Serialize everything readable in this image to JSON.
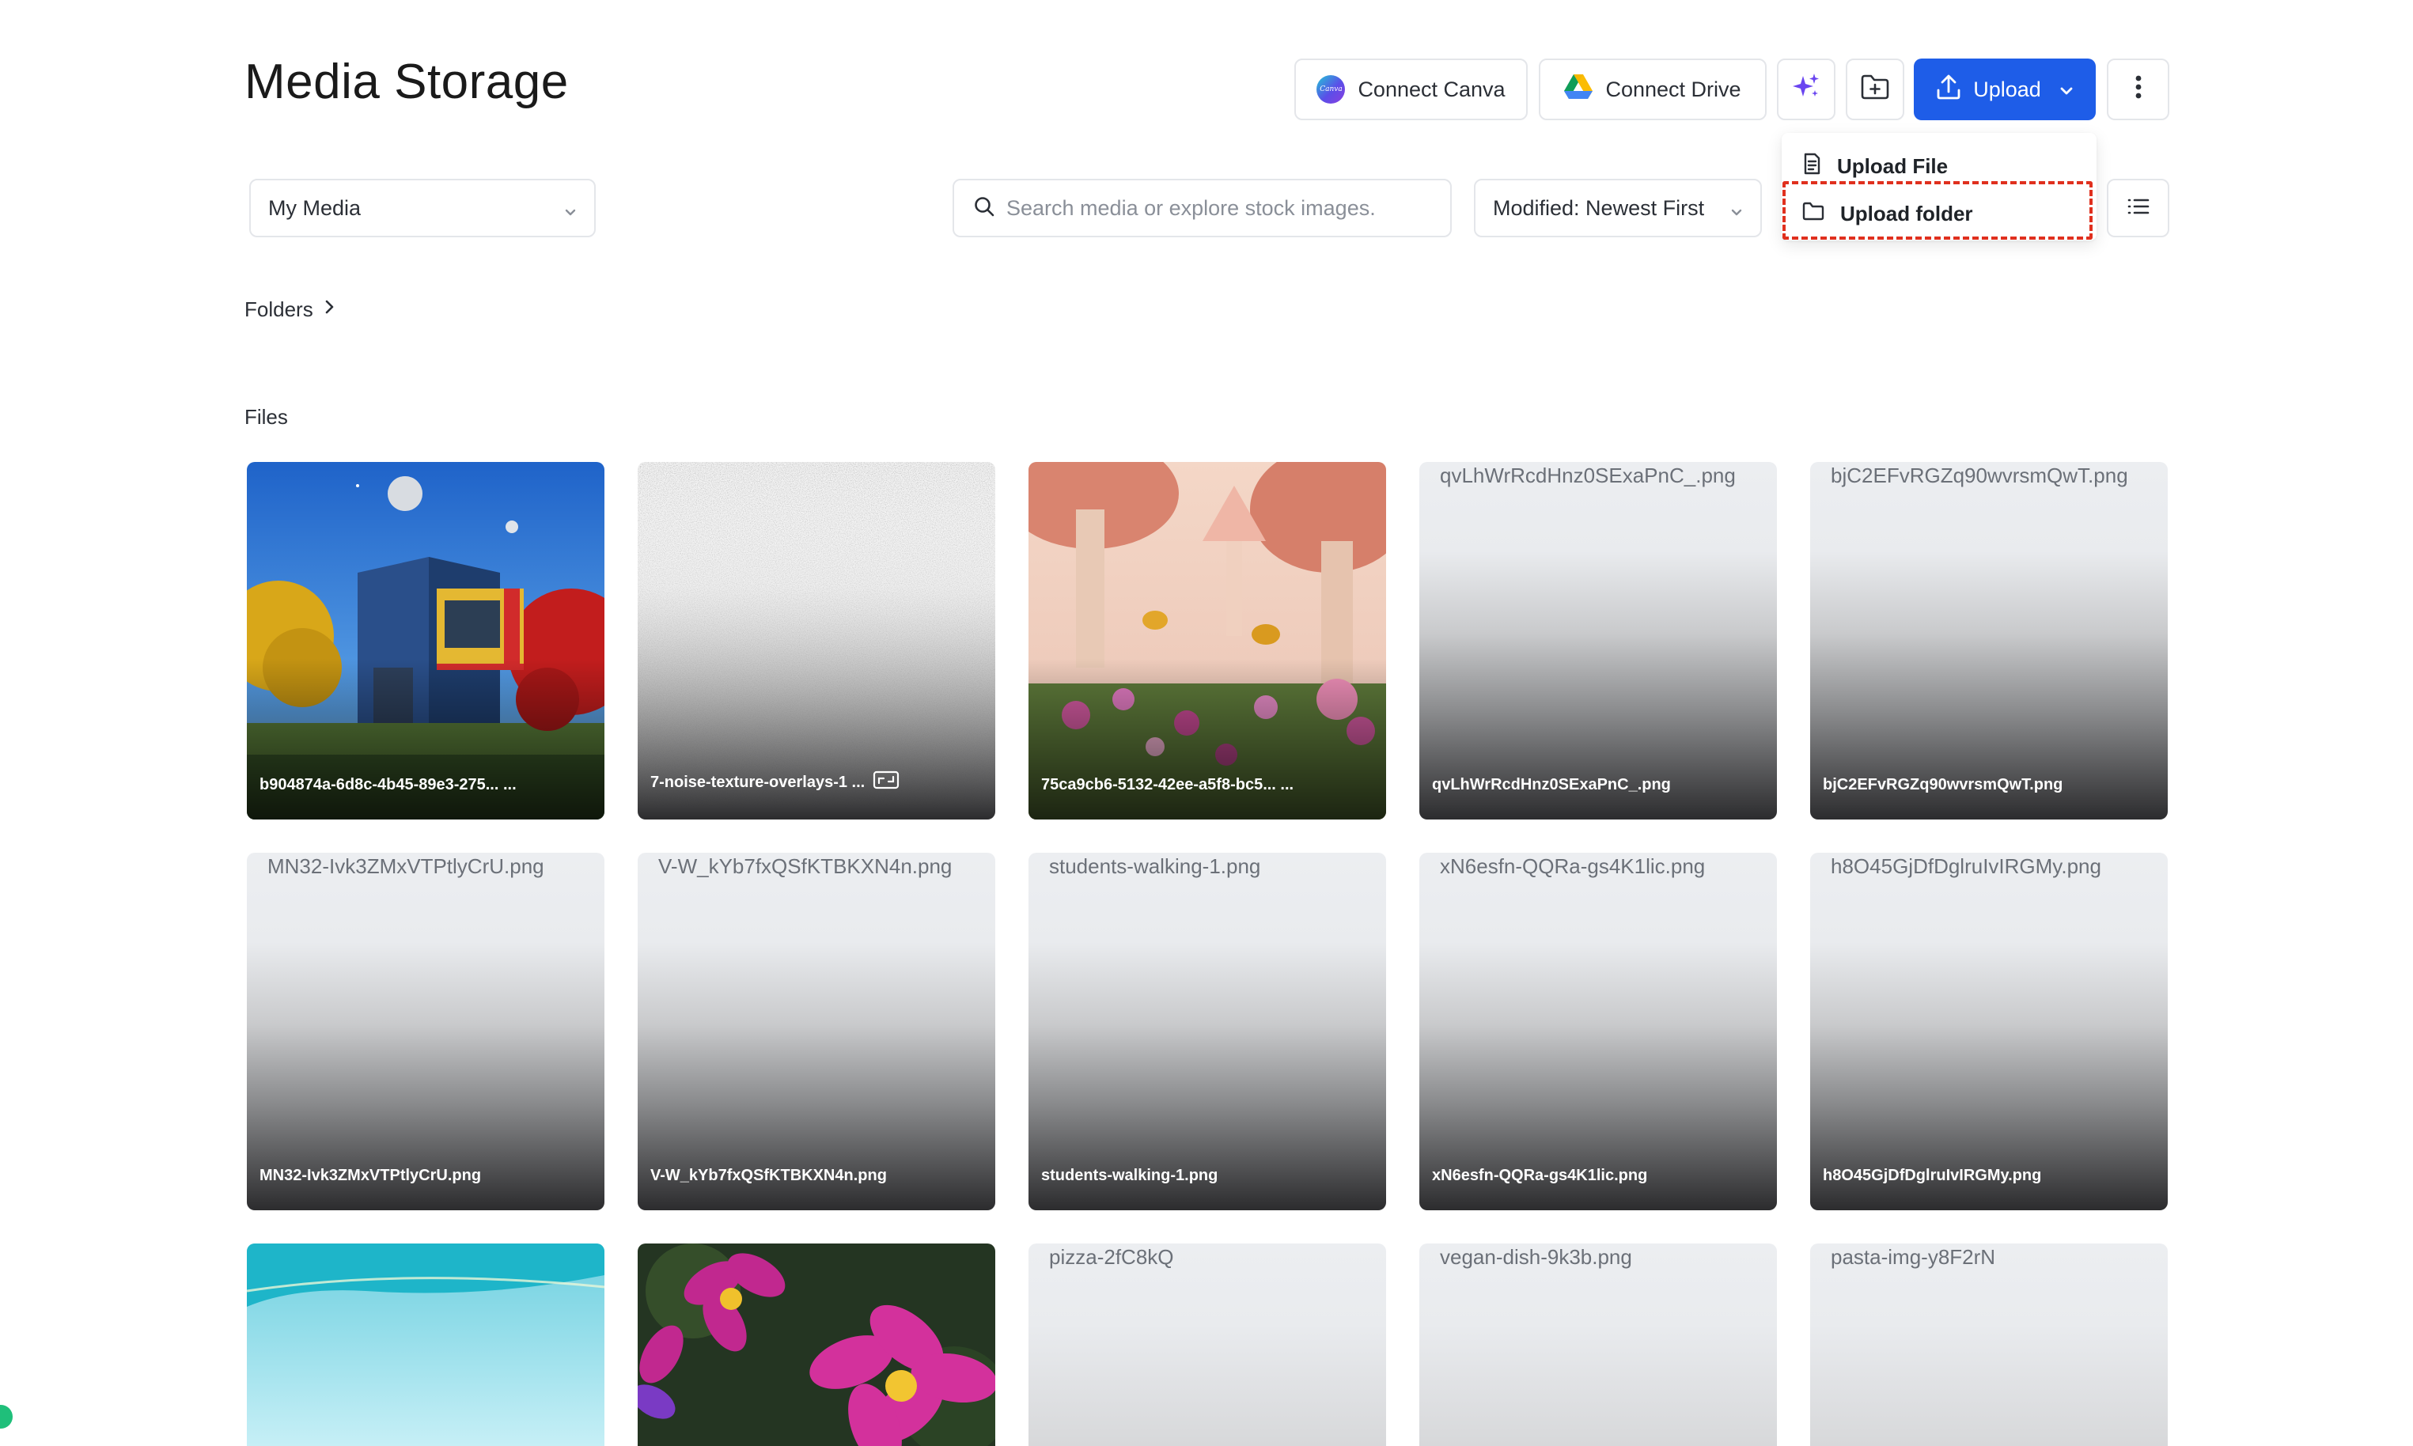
{
  "page": {
    "title": "Media Storage"
  },
  "toolbar": {
    "connect_canva": "Connect Canva",
    "canva_logo_text": "Canva",
    "connect_drive": "Connect Drive",
    "upload": "Upload"
  },
  "upload_menu": {
    "items": [
      {
        "label": "Upload File",
        "icon": "file-icon"
      },
      {
        "label": "Upload folder",
        "icon": "folder-icon",
        "highlighted": true
      }
    ]
  },
  "filters": {
    "source": "My Media",
    "search_placeholder": "Search media or explore stock images.",
    "sort": "Modified: Newest First"
  },
  "sections": {
    "folders": "Folders",
    "files": "Files"
  },
  "files": [
    {
      "name": "b904874a-6d8c-4b45-89e3-275... ...",
      "preview": "house"
    },
    {
      "name": "7-noise-texture-overlays-1 ...",
      "preview": "noise",
      "badge": "image-overlay-icon"
    },
    {
      "name": "75ca9cb6-5132-42ee-a5f8-bc5... ...",
      "preview": "garden"
    },
    {
      "name": "qvLhWrRcdHnz0SExaPnC_.png",
      "alt": "qvLhWrRcdHnz0SExaPnC_.png"
    },
    {
      "name": "bjC2EFvRGZq90wvrsmQwT.png",
      "alt": "bjC2EFvRGZq90wvrsmQwT.png"
    },
    {
      "name": "MN32-Ivk3ZMxVTPtlyCrU.png",
      "alt": "MN32-Ivk3ZMxVTPtlyCrU.png"
    },
    {
      "name": "V-W_kYb7fxQSfKTBKXN4n.png",
      "alt": "V-W_kYb7fxQSfKTBKXN4n.png"
    },
    {
      "name": "students-walking-1.png",
      "alt": "students-walking-1.png"
    },
    {
      "name": "xN6esfn-QQRa-gs4K1lic.png",
      "alt": "xN6esfn-QQRa-gs4K1lic.png"
    },
    {
      "name": "h8O45GjDfDglruIvIRGMy.png",
      "alt": "h8O45GjDfDglruIvIRGMy.png"
    },
    {
      "preview": "water"
    },
    {
      "preview": "flower"
    },
    {
      "alt": "pizza-2fC8kQ"
    },
    {
      "alt": "vegan-dish-9k3b.png"
    },
    {
      "alt": "pasta-img-y8F2rN"
    }
  ],
  "colors": {
    "primary": "#1e5de8",
    "highlight": "#e0301e",
    "status": "#1fbf7a"
  }
}
